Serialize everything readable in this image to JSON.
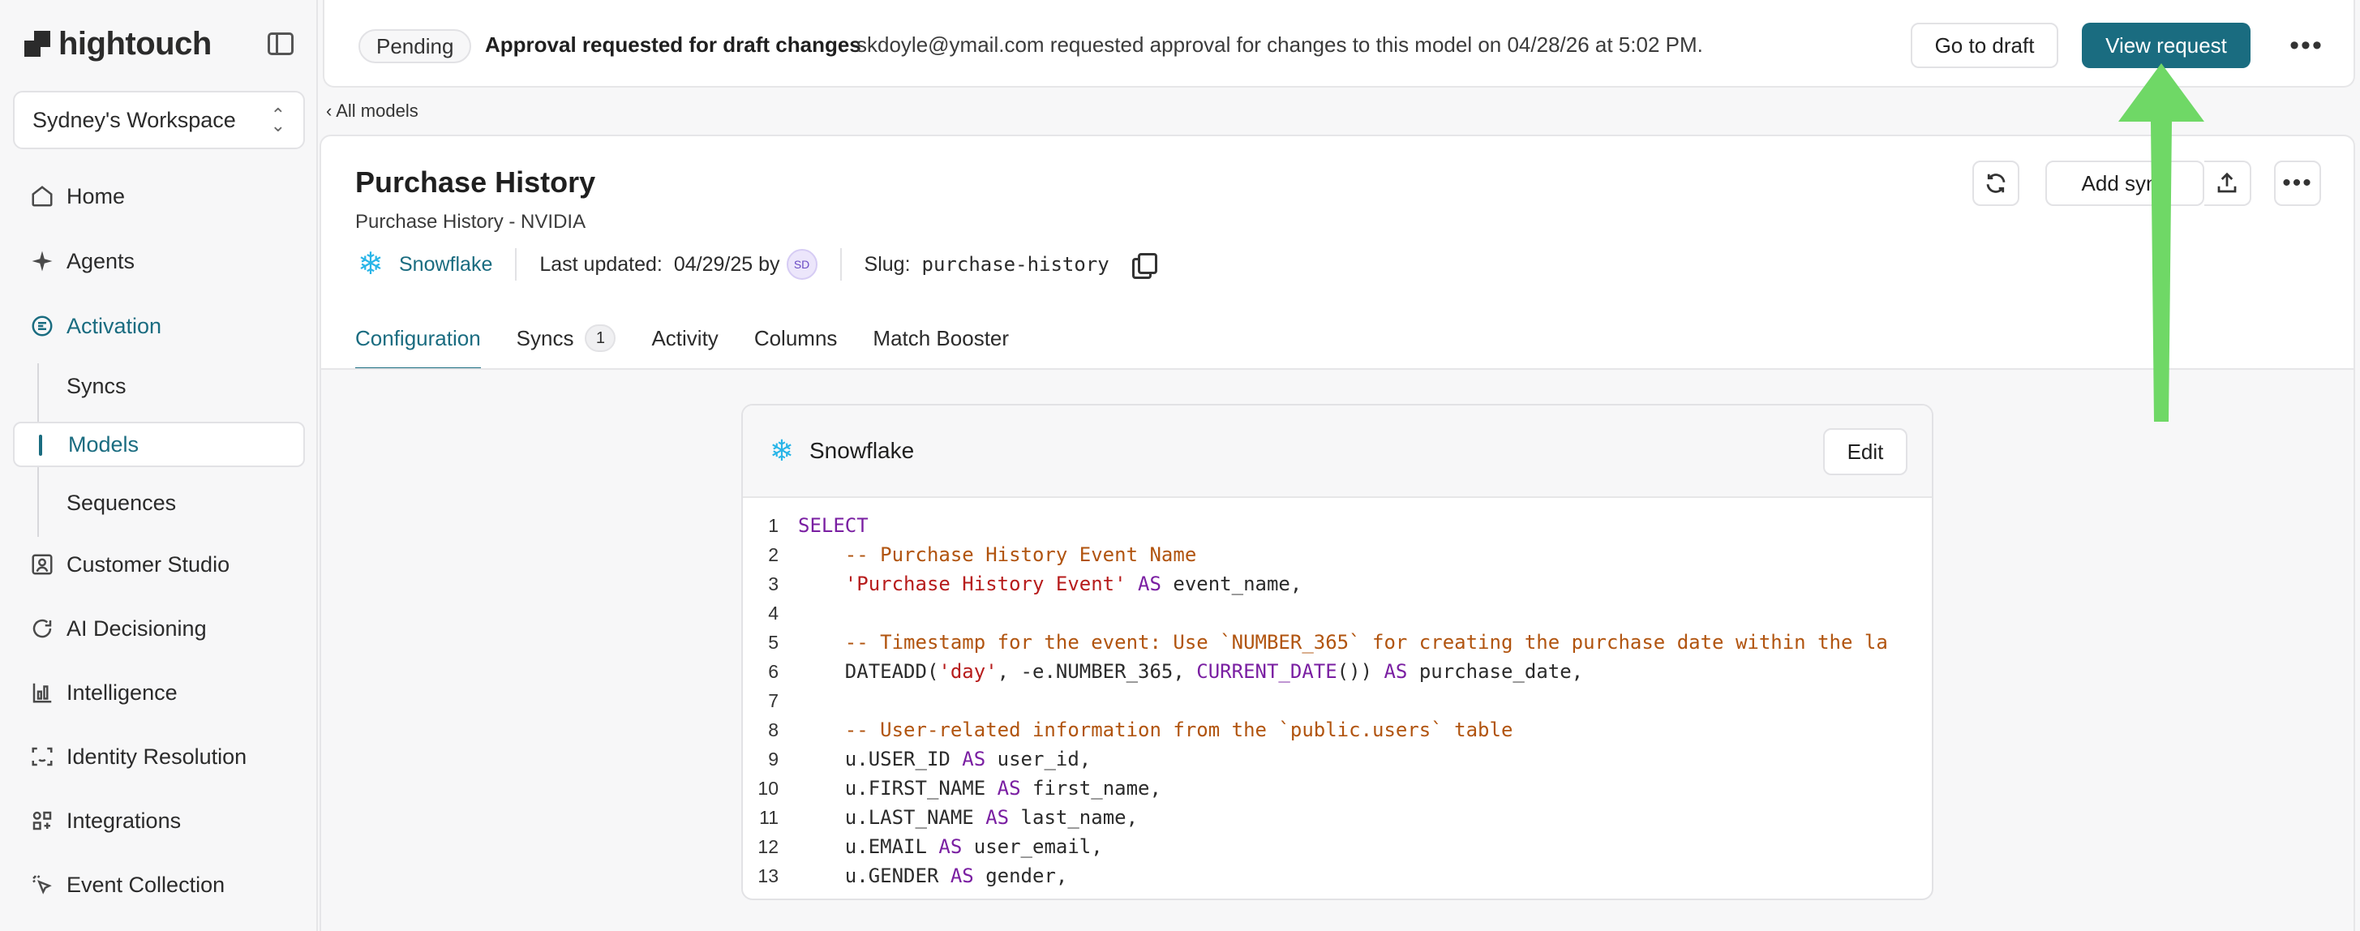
{
  "sidebar": {
    "logo": "hightouch",
    "workspace": "Sydney's Workspace",
    "items": [
      {
        "label": "Home",
        "icon": "home-icon"
      },
      {
        "label": "Agents",
        "icon": "sparkle-icon"
      },
      {
        "label": "Activation",
        "icon": "activation-icon"
      },
      {
        "label": "Customer Studio",
        "icon": "user-square-icon"
      },
      {
        "label": "AI Decisioning",
        "icon": "cycle-icon"
      },
      {
        "label": "Intelligence",
        "icon": "chart-icon"
      },
      {
        "label": "Identity Resolution",
        "icon": "scan-face-icon"
      },
      {
        "label": "Integrations",
        "icon": "grid-icon"
      },
      {
        "label": "Event Collection",
        "icon": "cursor-click-icon"
      }
    ],
    "sub_items": [
      {
        "label": "Syncs"
      },
      {
        "label": "Models"
      },
      {
        "label": "Sequences"
      }
    ]
  },
  "banner": {
    "status": "Pending",
    "title": "Approval requested for draft changes",
    "message": "skdoyle@ymail.com requested approval for changes to this model on 04/28/26 at 5:02 PM.",
    "go_to_draft": "Go to draft",
    "view_request": "View request"
  },
  "breadcrumb": {
    "back": "All models"
  },
  "model": {
    "title": "Purchase History",
    "subtitle": "Purchase History - NVIDIA",
    "source": "Snowflake",
    "last_updated_label": "Last updated:",
    "last_updated_value": "04/29/25 by",
    "avatar_initials": "SD",
    "slug_label": "Slug:",
    "slug_value": "purchase-history",
    "add_sync": "Add sync"
  },
  "tabs": [
    {
      "label": "Configuration",
      "active": true
    },
    {
      "label": "Syncs",
      "count": "1"
    },
    {
      "label": "Activity"
    },
    {
      "label": "Columns"
    },
    {
      "label": "Match Booster"
    }
  ],
  "query": {
    "source": "Snowflake",
    "edit": "Edit",
    "lines": [
      [
        {
          "t": "kw",
          "v": "SELECT"
        }
      ],
      [
        {
          "t": "pl",
          "v": "    "
        },
        {
          "t": "cm",
          "v": "-- Purchase History Event Name"
        }
      ],
      [
        {
          "t": "pl",
          "v": "    "
        },
        {
          "t": "st",
          "v": "'Purchase History Event'"
        },
        {
          "t": "pl",
          "v": " "
        },
        {
          "t": "kw",
          "v": "AS"
        },
        {
          "t": "pl",
          "v": " event_name,"
        }
      ],
      [],
      [
        {
          "t": "pl",
          "v": "    "
        },
        {
          "t": "cm",
          "v": "-- Timestamp for the event: Use `NUMBER_365` for creating the purchase date within the la"
        }
      ],
      [
        {
          "t": "pl",
          "v": "    DATEADD("
        },
        {
          "t": "st",
          "v": "'day'"
        },
        {
          "t": "pl",
          "v": ", -e.NUMBER_365, "
        },
        {
          "t": "kw",
          "v": "CURRENT_DATE"
        },
        {
          "t": "pl",
          "v": "()) "
        },
        {
          "t": "kw",
          "v": "AS"
        },
        {
          "t": "pl",
          "v": " purchase_date,"
        }
      ],
      [],
      [
        {
          "t": "pl",
          "v": "    "
        },
        {
          "t": "cm",
          "v": "-- User-related information from the `public.users` table"
        }
      ],
      [
        {
          "t": "pl",
          "v": "    u.USER_ID "
        },
        {
          "t": "kw",
          "v": "AS"
        },
        {
          "t": "pl",
          "v": " user_id,"
        }
      ],
      [
        {
          "t": "pl",
          "v": "    u.FIRST_NAME "
        },
        {
          "t": "kw",
          "v": "AS"
        },
        {
          "t": "pl",
          "v": " first_name,"
        }
      ],
      [
        {
          "t": "pl",
          "v": "    u.LAST_NAME "
        },
        {
          "t": "kw",
          "v": "AS"
        },
        {
          "t": "pl",
          "v": " last_name,"
        }
      ],
      [
        {
          "t": "pl",
          "v": "    u.EMAIL "
        },
        {
          "t": "kw",
          "v": "AS"
        },
        {
          "t": "pl",
          "v": " user_email,"
        }
      ],
      [
        {
          "t": "pl",
          "v": "    u.GENDER "
        },
        {
          "t": "kw",
          "v": "AS"
        },
        {
          "t": "pl",
          "v": " gender,"
        }
      ]
    ]
  },
  "colors": {
    "accent": "#1a6c80",
    "arrow": "#6fd866",
    "snowflake": "#29b5e8"
  }
}
